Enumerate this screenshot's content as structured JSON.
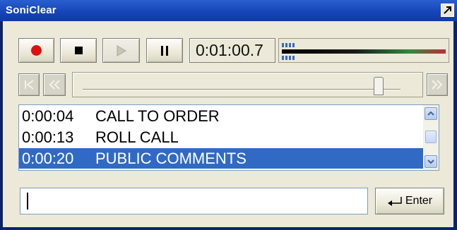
{
  "window": {
    "title": "SoniClear"
  },
  "transport": {
    "record_icon": "record-icon",
    "stop_icon": "stop-icon",
    "play_icon": "play-icon",
    "pause_icon": "pause-icon",
    "time": "0:01:00.7"
  },
  "navigation": {
    "prev_icon": "skip-to-start-icon",
    "rewind_icon": "rewind-icon",
    "forward_icon": "fast-forward-icon",
    "position": 0.93
  },
  "agenda": {
    "items": [
      {
        "time": "0:00:04",
        "label": "CALL TO ORDER",
        "selected": false
      },
      {
        "time": "0:00:13",
        "label": "ROLL CALL",
        "selected": false
      },
      {
        "time": "0:00:20",
        "label": "PUBLIC COMMENTS",
        "selected": true
      }
    ]
  },
  "entry": {
    "value": "",
    "enter_label": "Enter"
  },
  "colors": {
    "titlebar": "#1646b8",
    "record": "#e01010",
    "selection": "#316ac5"
  }
}
